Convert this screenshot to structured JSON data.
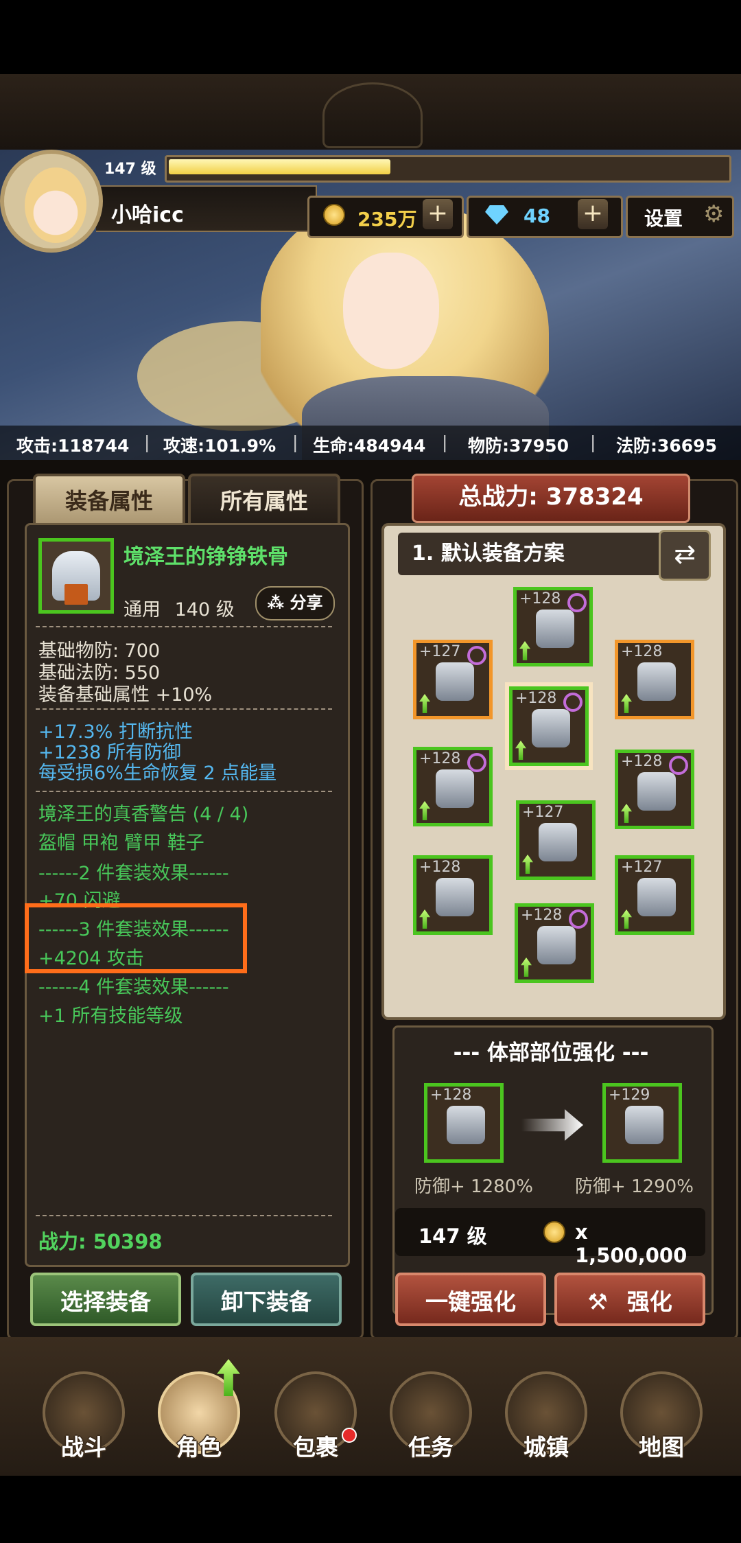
{
  "player": {
    "level_label": "147 级",
    "name": "小哈icc",
    "xp_progress": 0.4,
    "gold": "235万",
    "gems": "48",
    "settings_label": "设置"
  },
  "stats": {
    "attack": "攻击:118744",
    "attack_speed": "攻速:101.9%",
    "hp": "生命:484944",
    "phys_def": "物防:37950",
    "magic_def": "法防:36695",
    "separator": "|"
  },
  "tabs": {
    "equip_attrs": "装备属性",
    "all_attrs": "所有属性"
  },
  "item": {
    "name": "境泽王的铮铮铁骨",
    "type": "通用",
    "level": "140 级",
    "share": "分享",
    "base_lines": [
      "基础物防:  700",
      "基础法防:  550",
      "装备基础属性 +10%"
    ],
    "bonus_lines": [
      "+17.3% 打断抗性",
      "+1238 所有防御",
      "每受损6%生命恢复 2 点能量"
    ],
    "set_lines": [
      "境泽王的真香警告 (4 / 4)",
      "盔帽 甲袍 臂甲 鞋子",
      "------2 件套装效果------",
      "+70 闪避",
      "------3 件套装效果------",
      "+4204 攻击",
      "------4 件套装效果------",
      "+1 所有技能等级"
    ],
    "power": "战力:  50398"
  },
  "left_buttons": {
    "select": "选择装备",
    "unequip": "卸下装备"
  },
  "right": {
    "total_power": "总战力:  378324",
    "loadout": "1. 默认装备方案",
    "swap_icon": "⇄",
    "slots": [
      {
        "lvl": "+128",
        "border": "green",
        "spiral": true
      },
      {
        "lvl": "+127",
        "border": "orange",
        "spiral": true
      },
      {
        "lvl": "+128",
        "border": "orange",
        "spiral": false
      },
      {
        "lvl": "+128",
        "border": "green",
        "spiral": true
      },
      {
        "lvl": "+128",
        "border": "green",
        "spiral": true
      },
      {
        "lvl": "+128",
        "border": "green",
        "spiral": true
      },
      {
        "lvl": "+127",
        "border": "green",
        "spiral": false
      },
      {
        "lvl": "+128",
        "border": "green",
        "spiral": false
      },
      {
        "lvl": "+127",
        "border": "green",
        "spiral": false
      },
      {
        "lvl": "+128",
        "border": "green",
        "spiral": true
      }
    ],
    "upgrade": {
      "title": "--- 体部部位强化 ---",
      "from_lvl": "+128",
      "to_lvl": "+129",
      "from_pct": "防御+ 1280%",
      "to_pct": "防御+ 1290%",
      "cost_level": "147 级",
      "cost": "x 1,500,000"
    },
    "buttons": {
      "auto": "一键强化",
      "enhance": "强化"
    }
  },
  "nav": [
    {
      "label": "战斗",
      "icon": "swords-shield-icon"
    },
    {
      "label": "角色",
      "icon": "helmet-icon"
    },
    {
      "label": "包裹",
      "icon": "backpack-icon"
    },
    {
      "label": "任务",
      "icon": "scroll-icon"
    },
    {
      "label": "城镇",
      "icon": "tower-icon"
    },
    {
      "label": "地图",
      "icon": "map-icon"
    }
  ],
  "colors": {
    "set_green": "#48c85a",
    "bonus_blue": "#55b8f0",
    "highlight_orange": "#ff6d1a"
  }
}
